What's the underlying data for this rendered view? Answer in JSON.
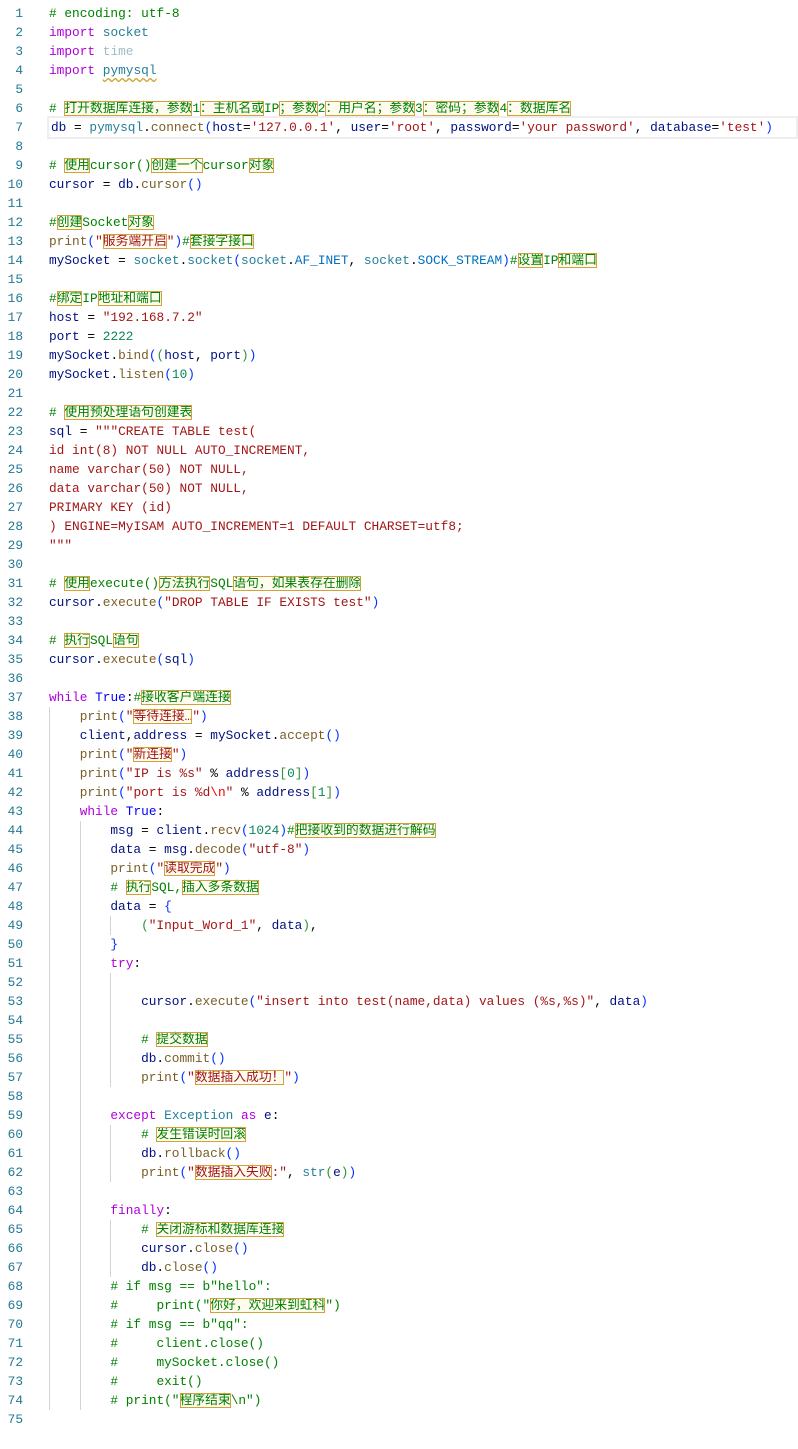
{
  "editor": {
    "language": "python",
    "current_line": 7,
    "colors": {
      "keyword": "#af00db",
      "comment": "#008000",
      "string": "#a31515",
      "function": "#795e26",
      "variable": "#001080",
      "number": "#098658",
      "type": "#267f99",
      "line_number": "#237893",
      "unicode_highlight": "#d1a13a"
    },
    "lines": [
      {
        "i": 0,
        "t": [
          [
            "c",
            "# encoding: utf-8"
          ]
        ]
      },
      {
        "i": 0,
        "t": [
          [
            "k",
            "import"
          ],
          [
            "o",
            " "
          ],
          [
            "m",
            "socket"
          ]
        ]
      },
      {
        "i": 0,
        "t": [
          [
            "k",
            "import"
          ],
          [
            "o",
            " "
          ],
          [
            "u",
            "time"
          ]
        ]
      },
      {
        "i": 0,
        "t": [
          [
            "k",
            "import"
          ],
          [
            "o",
            " "
          ],
          [
            "m sq",
            "pymysql"
          ]
        ]
      },
      {
        "i": 0,
        "t": []
      },
      {
        "i": 0,
        "t": [
          [
            "c",
            "# 打开数据库连接，参数1：主机名或IP；参数2：用户名；参数3：密码；参数4：数据库名"
          ]
        ]
      },
      {
        "i": 0,
        "t": [
          [
            "v",
            "db"
          ],
          [
            "o",
            " = "
          ],
          [
            "m",
            "pymysql"
          ],
          [
            "o",
            "."
          ],
          [
            "f",
            "connect"
          ],
          [
            "b1",
            "("
          ],
          [
            "v",
            "host"
          ],
          [
            "o",
            "="
          ],
          [
            "s",
            "'127.0.0.1'"
          ],
          [
            "o",
            ", "
          ],
          [
            "v",
            "user"
          ],
          [
            "o",
            "="
          ],
          [
            "s",
            "'root'"
          ],
          [
            "o",
            ", "
          ],
          [
            "v",
            "password"
          ],
          [
            "o",
            "="
          ],
          [
            "s",
            "'your password'"
          ],
          [
            "o",
            ", "
          ],
          [
            "v",
            "database"
          ],
          [
            "o",
            "="
          ],
          [
            "s",
            "'test'"
          ],
          [
            "b1",
            ")"
          ]
        ]
      },
      {
        "i": 0,
        "t": []
      },
      {
        "i": 0,
        "t": [
          [
            "c",
            "# 使用cursor()创建一个cursor对象"
          ]
        ]
      },
      {
        "i": 0,
        "t": [
          [
            "v",
            "cursor"
          ],
          [
            "o",
            " = "
          ],
          [
            "v",
            "db"
          ],
          [
            "o",
            "."
          ],
          [
            "f",
            "cursor"
          ],
          [
            "b1",
            "()"
          ]
        ]
      },
      {
        "i": 0,
        "t": []
      },
      {
        "i": 0,
        "t": [
          [
            "c",
            "#创建Socket对象"
          ]
        ]
      },
      {
        "i": 0,
        "t": [
          [
            "f",
            "print"
          ],
          [
            "b1",
            "("
          ],
          [
            "s",
            "\"服务端开启\""
          ],
          [
            "b1",
            ")"
          ],
          [
            "c",
            "#套接字接口"
          ]
        ]
      },
      {
        "i": 0,
        "t": [
          [
            "v",
            "mySocket"
          ],
          [
            "o",
            " = "
          ],
          [
            "m",
            "socket"
          ],
          [
            "o",
            "."
          ],
          [
            "m",
            "socket"
          ],
          [
            "b1",
            "("
          ],
          [
            "m",
            "socket"
          ],
          [
            "o",
            "."
          ],
          [
            "cn",
            "AF_INET"
          ],
          [
            "o",
            ", "
          ],
          [
            "m",
            "socket"
          ],
          [
            "o",
            "."
          ],
          [
            "cn",
            "SOCK_STREAM"
          ],
          [
            "b1",
            ")"
          ],
          [
            "c",
            "#设置IP和端口"
          ]
        ]
      },
      {
        "i": 0,
        "t": []
      },
      {
        "i": 0,
        "t": [
          [
            "c",
            "#绑定IP地址和端口"
          ]
        ]
      },
      {
        "i": 0,
        "t": [
          [
            "v",
            "host"
          ],
          [
            "o",
            " = "
          ],
          [
            "s",
            "\"192.168.7.2\""
          ]
        ]
      },
      {
        "i": 0,
        "t": [
          [
            "v",
            "port"
          ],
          [
            "o",
            " = "
          ],
          [
            "n",
            "2222"
          ]
        ]
      },
      {
        "i": 0,
        "t": [
          [
            "v",
            "mySocket"
          ],
          [
            "o",
            "."
          ],
          [
            "f",
            "bind"
          ],
          [
            "b1",
            "("
          ],
          [
            "b2",
            "("
          ],
          [
            "v",
            "host"
          ],
          [
            "o",
            ", "
          ],
          [
            "v",
            "port"
          ],
          [
            "b2",
            ")"
          ],
          [
            "b1",
            ")"
          ]
        ]
      },
      {
        "i": 0,
        "t": [
          [
            "v",
            "mySocket"
          ],
          [
            "o",
            "."
          ],
          [
            "f",
            "listen"
          ],
          [
            "b1",
            "("
          ],
          [
            "n",
            "10"
          ],
          [
            "b1",
            ")"
          ]
        ]
      },
      {
        "i": 0,
        "t": []
      },
      {
        "i": 0,
        "t": [
          [
            "c",
            "# 使用预处理语句创建表"
          ]
        ]
      },
      {
        "i": 0,
        "t": [
          [
            "v",
            "sql"
          ],
          [
            "o",
            " = "
          ],
          [
            "s",
            "\"\"\"CREATE TABLE test("
          ]
        ]
      },
      {
        "i": 0,
        "t": [
          [
            "s",
            "id int(8) NOT NULL AUTO_INCREMENT,"
          ]
        ]
      },
      {
        "i": 0,
        "t": [
          [
            "s",
            "name varchar(50) NOT NULL,"
          ]
        ]
      },
      {
        "i": 0,
        "t": [
          [
            "s",
            "data varchar(50) NOT NULL,"
          ]
        ]
      },
      {
        "i": 0,
        "t": [
          [
            "s",
            "PRIMARY KEY (id)"
          ]
        ]
      },
      {
        "i": 0,
        "t": [
          [
            "s",
            ") ENGINE=MyISAM AUTO_INCREMENT=1 DEFAULT CHARSET=utf8;"
          ]
        ]
      },
      {
        "i": 0,
        "t": [
          [
            "s",
            "\"\"\""
          ]
        ]
      },
      {
        "i": 0,
        "t": []
      },
      {
        "i": 0,
        "t": [
          [
            "c",
            "# 使用execute()方法执行SQL语句，如果表存在删除"
          ]
        ]
      },
      {
        "i": 0,
        "t": [
          [
            "v",
            "cursor"
          ],
          [
            "o",
            "."
          ],
          [
            "f",
            "execute"
          ],
          [
            "b1",
            "("
          ],
          [
            "s",
            "\"DROP TABLE IF EXISTS test\""
          ],
          [
            "b1",
            ")"
          ]
        ]
      },
      {
        "i": 0,
        "t": []
      },
      {
        "i": 0,
        "t": [
          [
            "c",
            "# 执行SQL语句"
          ]
        ]
      },
      {
        "i": 0,
        "t": [
          [
            "v",
            "cursor"
          ],
          [
            "o",
            "."
          ],
          [
            "f",
            "execute"
          ],
          [
            "b1",
            "("
          ],
          [
            "v",
            "sql"
          ],
          [
            "b1",
            ")"
          ]
        ]
      },
      {
        "i": 0,
        "t": []
      },
      {
        "i": 0,
        "t": [
          [
            "k",
            "while"
          ],
          [
            "o",
            " "
          ],
          [
            "t",
            "True"
          ],
          [
            "o",
            ":"
          ],
          [
            "c",
            "#接收客户端连接"
          ]
        ]
      },
      {
        "i": 4,
        "t": [
          [
            "f",
            "print"
          ],
          [
            "b1",
            "("
          ],
          [
            "s",
            "\"等待连接…\""
          ],
          [
            "b1",
            ")"
          ]
        ]
      },
      {
        "i": 4,
        "t": [
          [
            "v",
            "client"
          ],
          [
            "o",
            ","
          ],
          [
            "v",
            "address"
          ],
          [
            "o",
            " = "
          ],
          [
            "v",
            "mySocket"
          ],
          [
            "o",
            "."
          ],
          [
            "f",
            "accept"
          ],
          [
            "b1",
            "()"
          ]
        ]
      },
      {
        "i": 4,
        "t": [
          [
            "f",
            "print"
          ],
          [
            "b1",
            "("
          ],
          [
            "s",
            "\"新连接\""
          ],
          [
            "b1",
            ")"
          ]
        ]
      },
      {
        "i": 4,
        "t": [
          [
            "f",
            "print"
          ],
          [
            "b1",
            "("
          ],
          [
            "s",
            "\"IP is %s\""
          ],
          [
            "o",
            " % "
          ],
          [
            "v",
            "address"
          ],
          [
            "b2",
            "["
          ],
          [
            "n",
            "0"
          ],
          [
            "b2",
            "]"
          ],
          [
            "b1",
            ")"
          ]
        ]
      },
      {
        "i": 4,
        "t": [
          [
            "f",
            "print"
          ],
          [
            "b1",
            "("
          ],
          [
            "s",
            "\"port is %d"
          ],
          [
            "e",
            "\\n"
          ],
          [
            "s",
            "\""
          ],
          [
            "o",
            " % "
          ],
          [
            "v",
            "address"
          ],
          [
            "b2",
            "["
          ],
          [
            "n",
            "1"
          ],
          [
            "b2",
            "]"
          ],
          [
            "b1",
            ")"
          ]
        ]
      },
      {
        "i": 4,
        "t": [
          [
            "k",
            "while"
          ],
          [
            "o",
            " "
          ],
          [
            "t",
            "True"
          ],
          [
            "o",
            ":"
          ]
        ]
      },
      {
        "i": 8,
        "t": [
          [
            "v",
            "msg"
          ],
          [
            "o",
            " = "
          ],
          [
            "v",
            "client"
          ],
          [
            "o",
            "."
          ],
          [
            "f",
            "recv"
          ],
          [
            "b1",
            "("
          ],
          [
            "n",
            "1024"
          ],
          [
            "b1",
            ")"
          ],
          [
            "c",
            "#把接收到的数据进行解码"
          ]
        ]
      },
      {
        "i": 8,
        "t": [
          [
            "v",
            "data"
          ],
          [
            "o",
            " = "
          ],
          [
            "v",
            "msg"
          ],
          [
            "o",
            "."
          ],
          [
            "f",
            "decode"
          ],
          [
            "b1",
            "("
          ],
          [
            "s",
            "\"utf-8\""
          ],
          [
            "b1",
            ")"
          ]
        ]
      },
      {
        "i": 8,
        "t": [
          [
            "f",
            "print"
          ],
          [
            "b1",
            "("
          ],
          [
            "s",
            "\"读取完成\""
          ],
          [
            "b1",
            ")"
          ]
        ]
      },
      {
        "i": 8,
        "t": [
          [
            "c",
            "# 执行SQL,插入多条数据"
          ]
        ]
      },
      {
        "i": 8,
        "t": [
          [
            "v",
            "data"
          ],
          [
            "o",
            " = "
          ],
          [
            "b1",
            "{"
          ]
        ]
      },
      {
        "i": 12,
        "t": [
          [
            "b2",
            "("
          ],
          [
            "s",
            "\"Input_Word_1\""
          ],
          [
            "o",
            ", "
          ],
          [
            "v",
            "data"
          ],
          [
            "b2",
            ")"
          ],
          [
            "o",
            ","
          ]
        ]
      },
      {
        "i": 8,
        "t": [
          [
            "b1",
            "}"
          ]
        ]
      },
      {
        "i": 8,
        "t": [
          [
            "k",
            "try"
          ],
          [
            "o",
            ":"
          ]
        ]
      },
      {
        "i": 12,
        "t": []
      },
      {
        "i": 12,
        "t": [
          [
            "v",
            "cursor"
          ],
          [
            "o",
            "."
          ],
          [
            "f",
            "execute"
          ],
          [
            "b1",
            "("
          ],
          [
            "s",
            "\"insert into test(name,data) values (%s,%s)\""
          ],
          [
            "o",
            ", "
          ],
          [
            "v",
            "data"
          ],
          [
            "b1",
            ")"
          ]
        ]
      },
      {
        "i": 12,
        "t": []
      },
      {
        "i": 12,
        "t": [
          [
            "c",
            "# 提交数据"
          ]
        ]
      },
      {
        "i": 12,
        "t": [
          [
            "v",
            "db"
          ],
          [
            "o",
            "."
          ],
          [
            "f",
            "commit"
          ],
          [
            "b1",
            "()"
          ]
        ]
      },
      {
        "i": 12,
        "t": [
          [
            "f",
            "print"
          ],
          [
            "b1",
            "("
          ],
          [
            "s",
            "\"数据插入成功！\""
          ],
          [
            "b1",
            ")"
          ]
        ]
      },
      {
        "i": 8,
        "t": []
      },
      {
        "i": 8,
        "t": [
          [
            "k",
            "except"
          ],
          [
            "o",
            " "
          ],
          [
            "m",
            "Exception"
          ],
          [
            "o",
            " "
          ],
          [
            "k",
            "as"
          ],
          [
            "o",
            " "
          ],
          [
            "v",
            "e"
          ],
          [
            "o",
            ":"
          ]
        ]
      },
      {
        "i": 12,
        "t": [
          [
            "c",
            "# 发生错误时回滚"
          ]
        ]
      },
      {
        "i": 12,
        "t": [
          [
            "v",
            "db"
          ],
          [
            "o",
            "."
          ],
          [
            "f",
            "rollback"
          ],
          [
            "b1",
            "()"
          ]
        ]
      },
      {
        "i": 12,
        "t": [
          [
            "f",
            "print"
          ],
          [
            "b1",
            "("
          ],
          [
            "s",
            "\"数据插入失败:\""
          ],
          [
            "o",
            ", "
          ],
          [
            "m",
            "str"
          ],
          [
            "b2",
            "("
          ],
          [
            "v",
            "e"
          ],
          [
            "b2",
            ")"
          ],
          [
            "b1",
            ")"
          ]
        ]
      },
      {
        "i": 8,
        "t": []
      },
      {
        "i": 8,
        "t": [
          [
            "k",
            "finally"
          ],
          [
            "o",
            ":"
          ]
        ]
      },
      {
        "i": 12,
        "t": [
          [
            "c",
            "# 关闭游标和数据库连接"
          ]
        ]
      },
      {
        "i": 12,
        "t": [
          [
            "v",
            "cursor"
          ],
          [
            "o",
            "."
          ],
          [
            "f",
            "close"
          ],
          [
            "b1",
            "()"
          ]
        ]
      },
      {
        "i": 12,
        "t": [
          [
            "v",
            "db"
          ],
          [
            "o",
            "."
          ],
          [
            "f",
            "close"
          ],
          [
            "b1",
            "()"
          ]
        ]
      },
      {
        "i": 8,
        "t": [
          [
            "c",
            "# if msg == b\"hello\":"
          ]
        ]
      },
      {
        "i": 8,
        "t": [
          [
            "c",
            "#     print(\"你好，欢迎来到虹科\")"
          ]
        ]
      },
      {
        "i": 8,
        "t": [
          [
            "c",
            "# if msg == b\"qq\":"
          ]
        ]
      },
      {
        "i": 8,
        "t": [
          [
            "c",
            "#     client.close()"
          ]
        ]
      },
      {
        "i": 8,
        "t": [
          [
            "c",
            "#     mySocket.close()"
          ]
        ]
      },
      {
        "i": 8,
        "t": [
          [
            "c",
            "#     exit()"
          ]
        ]
      },
      {
        "i": 8,
        "t": [
          [
            "c",
            "# print(\"程序结束\\n\")"
          ]
        ]
      },
      {
        "i": 0,
        "t": []
      }
    ]
  }
}
